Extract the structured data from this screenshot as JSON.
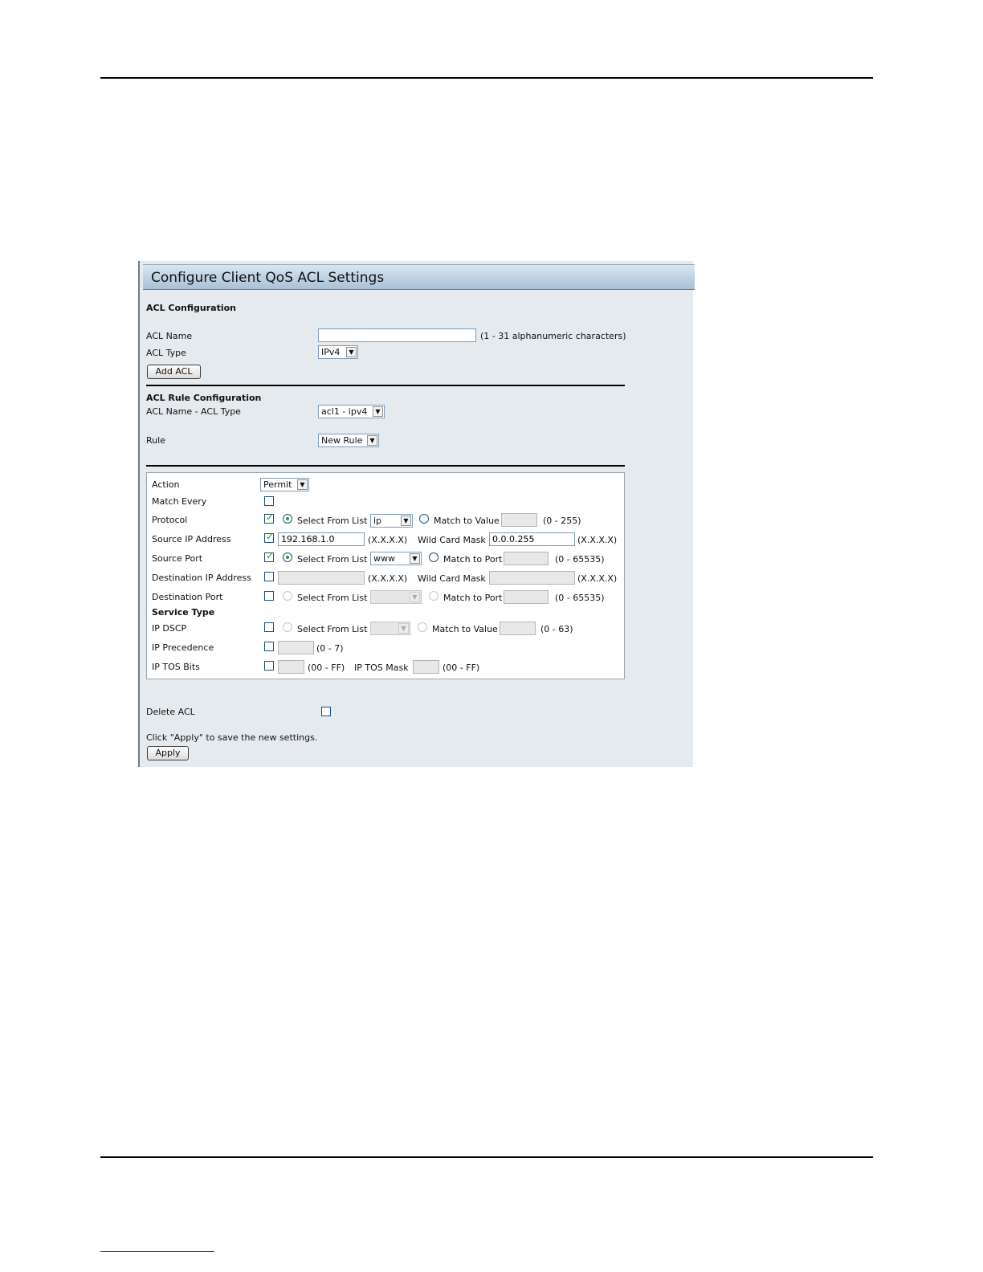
{
  "panel": {
    "title": "Configure Client QoS ACL Settings"
  },
  "acl_config": {
    "section_title": "ACL Configuration",
    "name_label": "ACL Name",
    "name_value": "",
    "name_hint": "(1 - 31 alphanumeric characters)",
    "type_label": "ACL Type",
    "type_value": "IPv4",
    "add_button": "Add ACL"
  },
  "rule_config": {
    "section_title": "ACL Rule Configuration",
    "name_type_label": "ACL Name - ACL Type",
    "name_type_value": "acl1 - ipv4",
    "rule_label": "Rule",
    "rule_value": "New Rule"
  },
  "rule": {
    "action_label": "Action",
    "action_value": "Permit",
    "match_every_label": "Match Every",
    "protocol_label": "Protocol",
    "select_from_list": "Select From List",
    "match_to_value": "Match to Value",
    "match_to_port": "Match to Port",
    "protocol_list_value": "ip",
    "range_0_255": "(0 - 255)",
    "source_ip_label": "Source IP Address",
    "source_ip_value": "192.168.1.0",
    "ip_format": "(X.X.X.X)",
    "wild_card_mask": "Wild Card Mask",
    "source_mask_value": "0.0.0.255",
    "source_port_label": "Source Port",
    "source_port_list_value": "www",
    "range_0_65535": "(0 - 65535)",
    "dest_ip_label": "Destination IP Address",
    "dest_port_label": "Destination Port",
    "service_type_label": "Service Type",
    "ip_dscp_label": "IP DSCP",
    "range_0_63": "(0 - 63)",
    "ip_precedence_label": "IP Precedence",
    "range_0_7": "(0 - 7)",
    "ip_tos_bits_label": "IP TOS Bits",
    "range_00_ff": "(00 - FF)",
    "ip_tos_mask_label": "IP TOS Mask"
  },
  "footer": {
    "delete_label": "Delete ACL",
    "apply_hint": "Click \"Apply\" to save the new settings.",
    "apply_button": "Apply"
  },
  "colors": {
    "panel_bg": "#e5eaee",
    "header_gradient_start": "#d9e6f1",
    "header_gradient_end": "#a9c1d7",
    "check_green": "#21a121"
  }
}
